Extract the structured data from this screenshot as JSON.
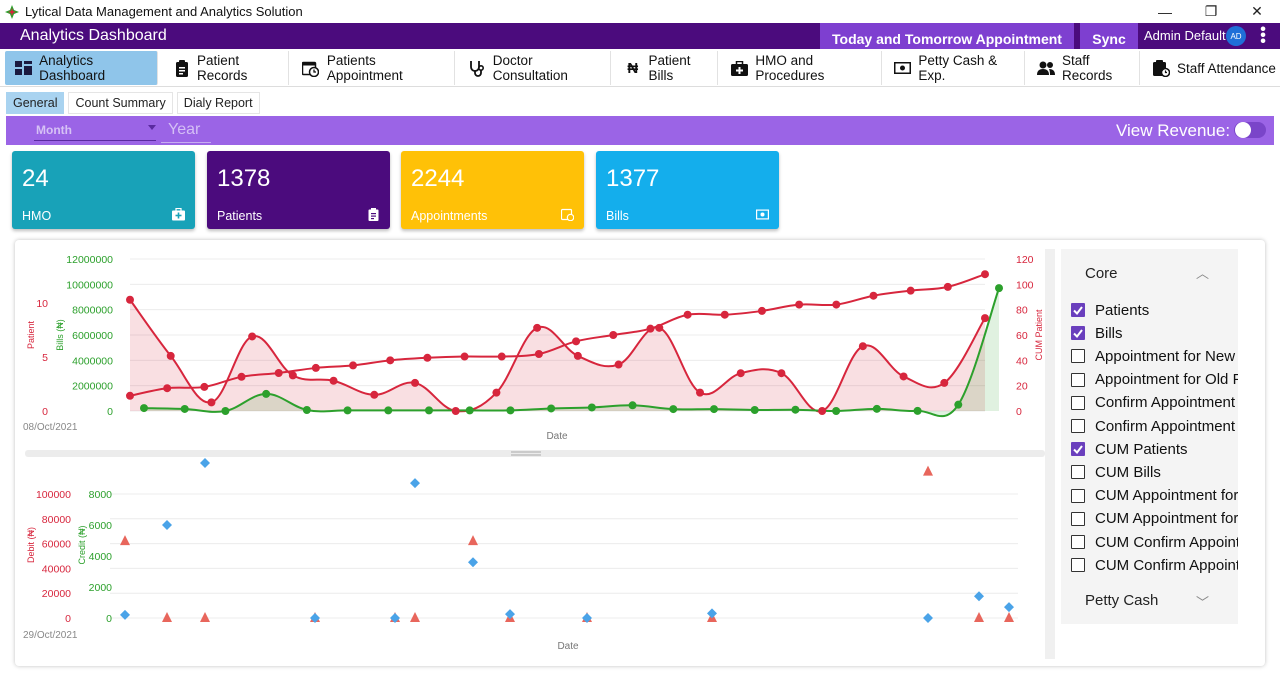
{
  "window": {
    "title": "Lytical Data Management and Analytics Solution",
    "minimize": "—",
    "restore": "❐",
    "close": "✕"
  },
  "header": {
    "title": "Analytics Dashboard",
    "appointment_button": "Today and Tomorrow Appointment",
    "sync_button": "Sync",
    "user": "Admin Default",
    "avatar": "AD",
    "menu": "⋮"
  },
  "nav": [
    {
      "label": "Analytics Dashboard",
      "icon": "dashboard-icon"
    },
    {
      "label": "Patient Records",
      "icon": "clipboard-icon"
    },
    {
      "label": "Patients Appointment",
      "icon": "calendar-clock-icon"
    },
    {
      "label": "Doctor Consultation",
      "icon": "stethoscope-icon"
    },
    {
      "label": "Patient Bills",
      "icon": "naira-icon"
    },
    {
      "label": "HMO and Procedures",
      "icon": "medkit-icon"
    },
    {
      "label": "Petty Cash & Exp.",
      "icon": "cash-icon"
    },
    {
      "label": "Staff Records",
      "icon": "users-icon"
    },
    {
      "label": "Staff Attendance",
      "icon": "attendance-icon"
    }
  ],
  "subtabs": [
    "General",
    "Count Summary",
    "Dialy Report"
  ],
  "filter": {
    "month_placeholder": "Month",
    "year_placeholder": "Year",
    "view_revenue": "View Revenue:"
  },
  "cards": [
    {
      "value": "24",
      "label": "HMO",
      "color": "#18a2b8"
    },
    {
      "value": "1378",
      "label": "Patients",
      "color": "#4b0b7d"
    },
    {
      "value": "2244",
      "label": "Appointments",
      "color": "#ffc107"
    },
    {
      "value": "1377",
      "label": "Bills",
      "color": "#14aeec"
    }
  ],
  "legend": {
    "core_title": "Core",
    "items": [
      {
        "label": "Patients",
        "checked": true
      },
      {
        "label": "Bills",
        "checked": true
      },
      {
        "label": "Appointment for New",
        "checked": false
      },
      {
        "label": "Appointment for Old P",
        "checked": false
      },
      {
        "label": "Confirm Appointment",
        "checked": false
      },
      {
        "label": "Confirm Appointment",
        "checked": false
      },
      {
        "label": "CUM Patients",
        "checked": true
      },
      {
        "label": "CUM Bills",
        "checked": false
      },
      {
        "label": "CUM Appointment for",
        "checked": false
      },
      {
        "label": "CUM Appointment for",
        "checked": false
      },
      {
        "label": "CUM Confirm Appoint",
        "checked": false
      },
      {
        "label": "CUM Confirm Appoint",
        "checked": false
      }
    ],
    "petty_title": "Petty Cash"
  },
  "chart_data": [
    {
      "type": "line",
      "xlabel": "Date",
      "x_start_label": "08/Oct/2021",
      "ylabels": {
        "left_outer": "Patient",
        "left_inner": "Bills (₦)",
        "right": "CUM Patient"
      },
      "ticks": {
        "bills": [
          "12000000",
          "10000000",
          "8000000",
          "6000000",
          "4000000",
          "2000000",
          "0"
        ],
        "patient": [
          "10",
          "5",
          "0"
        ],
        "cum": [
          "120",
          "100",
          "80",
          "60",
          "40",
          "20",
          "0"
        ]
      },
      "colors": {
        "patient": "#d7263d",
        "bills": "#2ca02c",
        "cum": "#d7263d"
      },
      "series": [
        {
          "name": "Patients",
          "axis": "patient",
          "values": [
            10.3,
            5.1,
            0.8,
            6.9,
            3.3,
            2.8,
            1.5,
            2.6,
            0.0,
            1.7,
            7.7,
            5.1,
            4.3,
            7.7,
            1.7,
            3.5,
            3.5,
            0.0,
            6.0,
            3.2,
            2.6,
            8.6
          ]
        },
        {
          "name": "Bills",
          "axis": "bills",
          "values": [
            230000,
            160000,
            0,
            1350000,
            80000,
            50000,
            50000,
            50000,
            50000,
            50000,
            200000,
            280000,
            450000,
            150000,
            150000,
            80000,
            100000,
            0,
            170000,
            10000,
            500000,
            9700000
          ]
        },
        {
          "name": "CUM Patients",
          "axis": "cum",
          "values": [
            12,
            18,
            19,
            27,
            30,
            34,
            36,
            40,
            42,
            43,
            43,
            45,
            55,
            60,
            65,
            76,
            76,
            79,
            84,
            84,
            91,
            95,
            98,
            108
          ]
        }
      ]
    },
    {
      "type": "scatter",
      "xlabel": "Date",
      "x_start_label": "29/Oct/2021",
      "ylabels": {
        "left_outer": "Debit (₦)",
        "left_inner": "Credit (₦)"
      },
      "ticks": {
        "debit": [
          "100000",
          "80000",
          "60000",
          "40000",
          "20000",
          "0"
        ],
        "credit": [
          "8000",
          "6000",
          "4000",
          "2000",
          "0"
        ]
      },
      "colors": {
        "debit": "#e8665c",
        "credit": "#4aa3e8"
      },
      "series": [
        {
          "name": "Debit",
          "axis": "debit",
          "marker": "triangle",
          "values": [
            62000,
            0,
            0,
            0,
            0,
            0,
            62000,
            0,
            0,
            0,
            118000,
            0,
            0
          ]
        },
        {
          "name": "Credit",
          "axis": "credit",
          "marker": "diamond",
          "values": [
            200,
            6000,
            10000,
            0,
            0,
            8700,
            3600,
            250,
            0,
            300,
            0,
            1400,
            700
          ]
        }
      ]
    }
  ]
}
